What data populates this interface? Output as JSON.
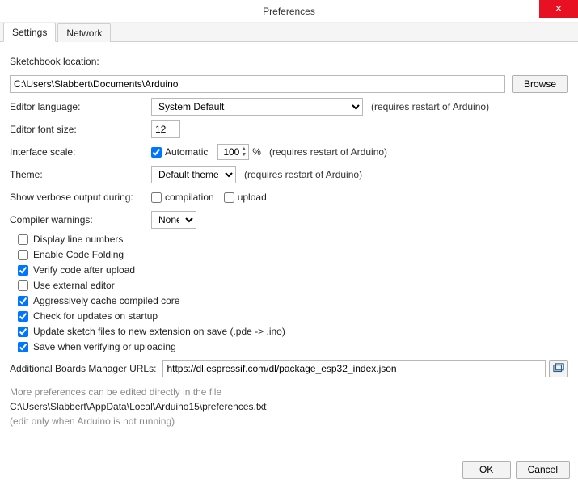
{
  "window": {
    "title": "Preferences",
    "close": "×"
  },
  "tabs": {
    "settings": "Settings",
    "network": "Network"
  },
  "labels": {
    "sketchbook": "Sketchbook location:",
    "browse": "Browse",
    "editor_language": "Editor language:",
    "restart_hint": "(requires restart of Arduino)",
    "font_size": "Editor font size:",
    "interface_scale": "Interface scale:",
    "automatic": "Automatic",
    "percent": "%",
    "theme": "Theme:",
    "verbose": "Show verbose output during:",
    "compilation": "compilation",
    "upload": "upload",
    "compiler_warnings": "Compiler warnings:",
    "line_numbers": "Display line numbers",
    "code_folding": "Enable Code Folding",
    "verify_upload": "Verify code after upload",
    "external_editor": "Use external editor",
    "aggressive_cache": "Aggressively cache compiled core",
    "check_updates": "Check for updates on startup",
    "update_ext": "Update sketch files to new extension on save (.pde -> .ino)",
    "save_verify": "Save when verifying or uploading",
    "boards_urls": "Additional Boards Manager URLs:",
    "more_prefs": "More preferences can be edited directly in the file",
    "prefs_path": "C:\\Users\\Slabbert\\AppData\\Local\\Arduino15\\preferences.txt",
    "edit_hint": "(edit only when Arduino is not running)",
    "ok": "OK",
    "cancel": "Cancel"
  },
  "values": {
    "sketchbook_path": "C:\\Users\\Slabbert\\Documents\\Arduino",
    "language": "System Default",
    "font_size": "12",
    "scale_auto": true,
    "scale_value": "100",
    "theme": "Default theme",
    "verbose_compilation": false,
    "verbose_upload": false,
    "compiler_warnings": "None",
    "display_line_numbers": false,
    "enable_code_folding": false,
    "verify_after_upload": true,
    "external_editor": false,
    "aggressive_cache": true,
    "check_updates": true,
    "update_ext": true,
    "save_verify": true,
    "boards_url": "https://dl.espressif.com/dl/package_esp32_index.json"
  }
}
